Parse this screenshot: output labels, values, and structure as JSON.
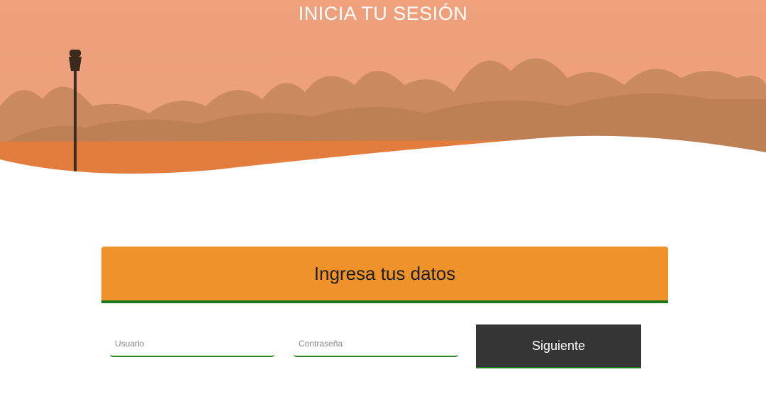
{
  "hero": {
    "title": "INICIA TU SESIÓN",
    "overlay_color": "#f0a07a"
  },
  "login": {
    "header": "Ingresa tus datos",
    "username_placeholder": "Usuario",
    "password_placeholder": "Contraseña",
    "next_label": "Siguiente"
  },
  "colors": {
    "accent": "#f0922a",
    "underline": "#1c7a1c",
    "button": "#353535"
  }
}
